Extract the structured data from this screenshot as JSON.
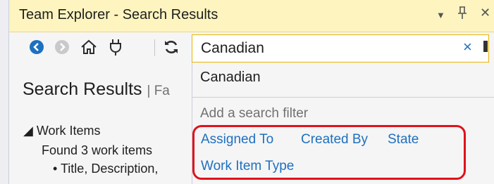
{
  "window": {
    "title": "Team Explorer - Search Results",
    "controls": {
      "dropdown": "▾",
      "pin": "ᵩ",
      "close": "×"
    }
  },
  "toolbar": {
    "icons": [
      "back-icon",
      "forward-icon",
      "home-icon",
      "connect-icon",
      "refresh-icon"
    ]
  },
  "search": {
    "value": "Canadian",
    "clear_glyph": "×"
  },
  "page": {
    "heading": "Search Results",
    "heading_suffix": "| Fa",
    "work_items_header": "◢ Work Items",
    "found_text": "Found 3 work items",
    "bullet_text": "• Title, Description,"
  },
  "dropdown": {
    "suggestion": "Canadian",
    "filter_label": "Add a search filter",
    "filters": {
      "assigned_to": "Assigned To",
      "created_by": "Created By",
      "state": "State",
      "work_item_type": "Work Item Type"
    }
  },
  "colors": {
    "titlebar": "#fdf4bf",
    "link": "#1e70c0",
    "highlight": "#e0121b",
    "accent_border": "#e8b400"
  }
}
